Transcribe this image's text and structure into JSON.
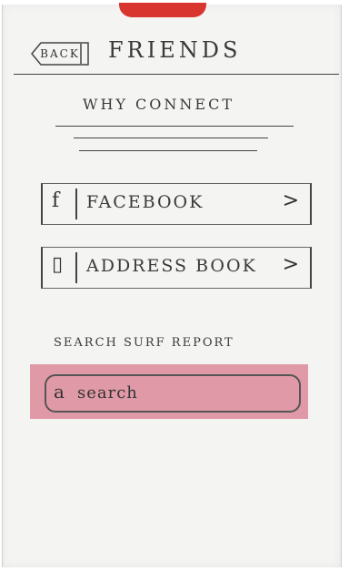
{
  "header": {
    "back_label": "BACK",
    "title": "FRIENDS"
  },
  "section": {
    "heading": "WHY CONNECT"
  },
  "connect_options": [
    {
      "icon": "f",
      "label": "FACEBOOK",
      "chevron": ">"
    },
    {
      "icon": "▯",
      "label": "ADDRESS BOOK",
      "chevron": ">"
    }
  ],
  "search": {
    "label": "SEARCH SURF REPORT",
    "placeholder": "search"
  },
  "colors": {
    "highlight": "#d97c8d",
    "tab": "#d9352f",
    "ink": "#3a3a3a"
  }
}
